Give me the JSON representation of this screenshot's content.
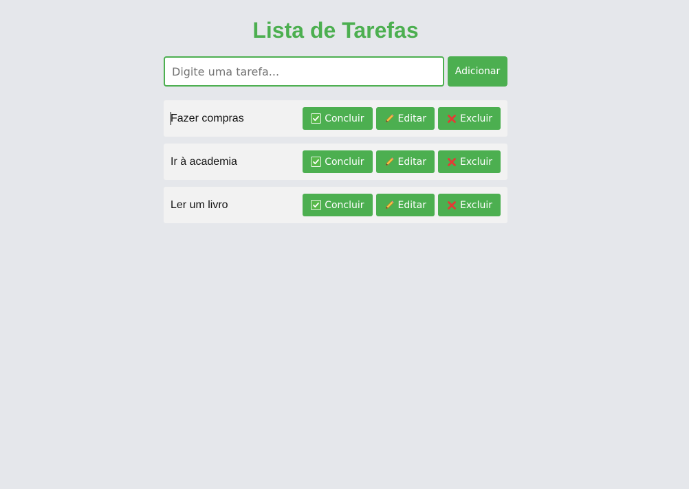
{
  "header": {
    "title": "Lista de Tarefas"
  },
  "add_form": {
    "input_value": "",
    "input_placeholder": "Digite uma tarefa...",
    "add_label": "Adicionar"
  },
  "actions": {
    "complete_label": "Concluir",
    "complete_icon": "check-mark-icon",
    "edit_label": "Editar",
    "edit_icon": "pencil-icon",
    "delete_label": "Excluir",
    "delete_icon": "cross-mark-icon"
  },
  "tasks": [
    {
      "text": "Fazer compras"
    },
    {
      "text": "Ir à academia"
    },
    {
      "text": "Ler um livro"
    }
  ],
  "colors": {
    "accent": "#4caf50",
    "background": "#e5e7eb",
    "task_background": "#f2f2f2",
    "delete_icon": "#e53935"
  }
}
